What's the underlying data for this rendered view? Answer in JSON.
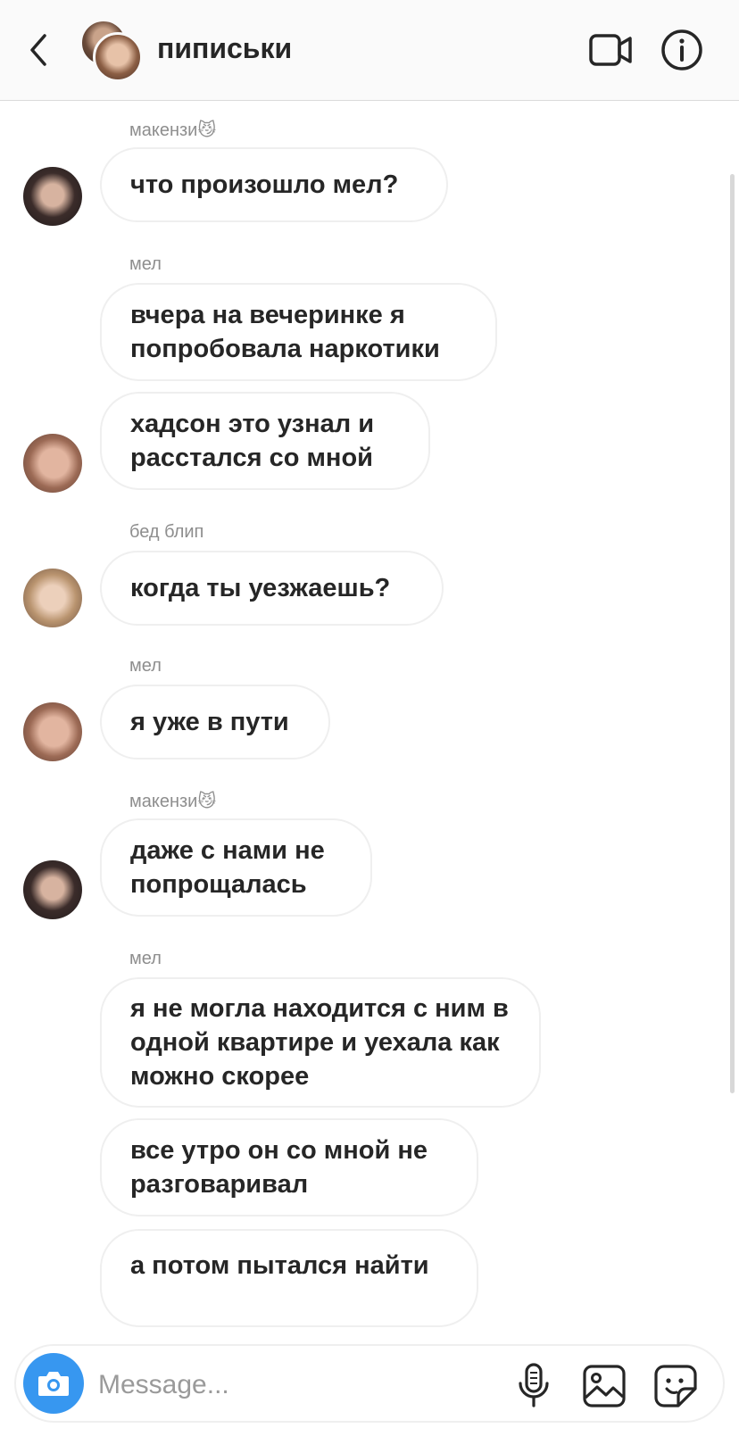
{
  "header": {
    "title": "пиписьки",
    "icons": {
      "back": "chevron-left-icon",
      "video": "video-camera-icon",
      "info": "info-icon"
    }
  },
  "messages": [
    {
      "sender": "макензи😼",
      "bubbles": [
        "что произошло мел?"
      ]
    },
    {
      "sender": "мел",
      "bubbles": [
        "вчера на вечеринке я попробовала наркотики",
        "хадсон это узнал и расстался со мной"
      ]
    },
    {
      "sender": "бед блип",
      "bubbles": [
        "когда ты уезжаешь?"
      ]
    },
    {
      "sender": "мел",
      "bubbles": [
        "я уже в пути"
      ]
    },
    {
      "sender": "макензи😼",
      "bubbles": [
        "даже с нами не попрощалась"
      ]
    },
    {
      "sender": "мел",
      "bubbles": [
        "я не могла находится с ним в одной квартире и уехала как можно скорее",
        "все утро он со мной не разговаривал",
        "а потом пытался найти"
      ]
    }
  ],
  "composer": {
    "placeholder": "Message...",
    "icons": {
      "camera": "camera-icon",
      "mic": "microphone-icon",
      "gallery": "gallery-icon",
      "sticker": "sticker-icon"
    }
  },
  "colors": {
    "accent": "#3797f0",
    "header_bg": "#fafafa",
    "bubble_border": "#efefef",
    "sender_text": "#8e8e8e"
  }
}
